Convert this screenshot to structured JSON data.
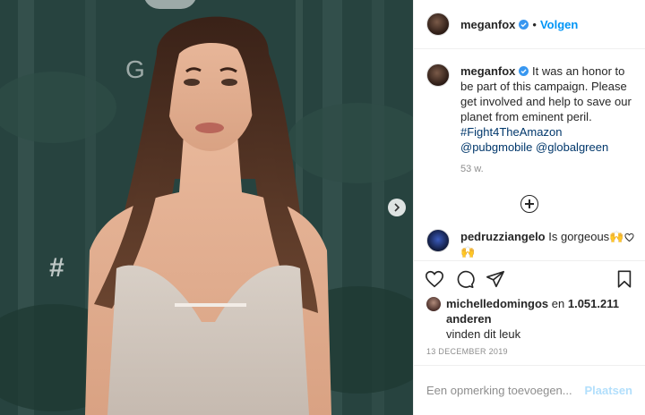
{
  "header": {
    "username": "meganfox",
    "separator": "•",
    "follow_label": "Volgen"
  },
  "caption": {
    "username": "meganfox",
    "text": "It was an honor to be part of this campaign. Please get involved and help to save our planet from eminent peril.",
    "hashtag": "#Fight4TheAmazon",
    "mention1": "@pubgmobile",
    "mention2": "@globalgreen",
    "time": "53 w."
  },
  "comment": {
    "username": "pedruzziangelo",
    "text": "Is gorgeous",
    "emoji_row_1": "🙌🙌",
    "emoji_rows": [
      "🙌🙌🙌🙌🙌🙌🙌🙌🙌🙌",
      "🙌🙌🙌🙌🙌🙌🙌🙌🙌🙌",
      "🙌🙌🙌🙌🙌🙌🙌🙌🙌🙌",
      "🙌🙌🙌🙌🙌🙌🙌🙌🙌🙌",
      "🙌🙌🙌🙌🙌🙌🙌🙌🙌🙌"
    ]
  },
  "likes": {
    "user": "michelledomingos",
    "connector": "en",
    "count": "1.051.211 anderen",
    "suffix": "vinden dit leuk"
  },
  "date": "13 DECEMBER 2019",
  "add_comment": {
    "placeholder": "Een opmerking toevoegen...",
    "post_label": "Plaatsen"
  },
  "media": {
    "watermark_letter": "G",
    "watermark_hash": "#"
  },
  "colors": {
    "accent": "#0095f6",
    "link": "#00376b",
    "muted": "#8e8e8e",
    "post_disabled": "#b2dffc"
  }
}
